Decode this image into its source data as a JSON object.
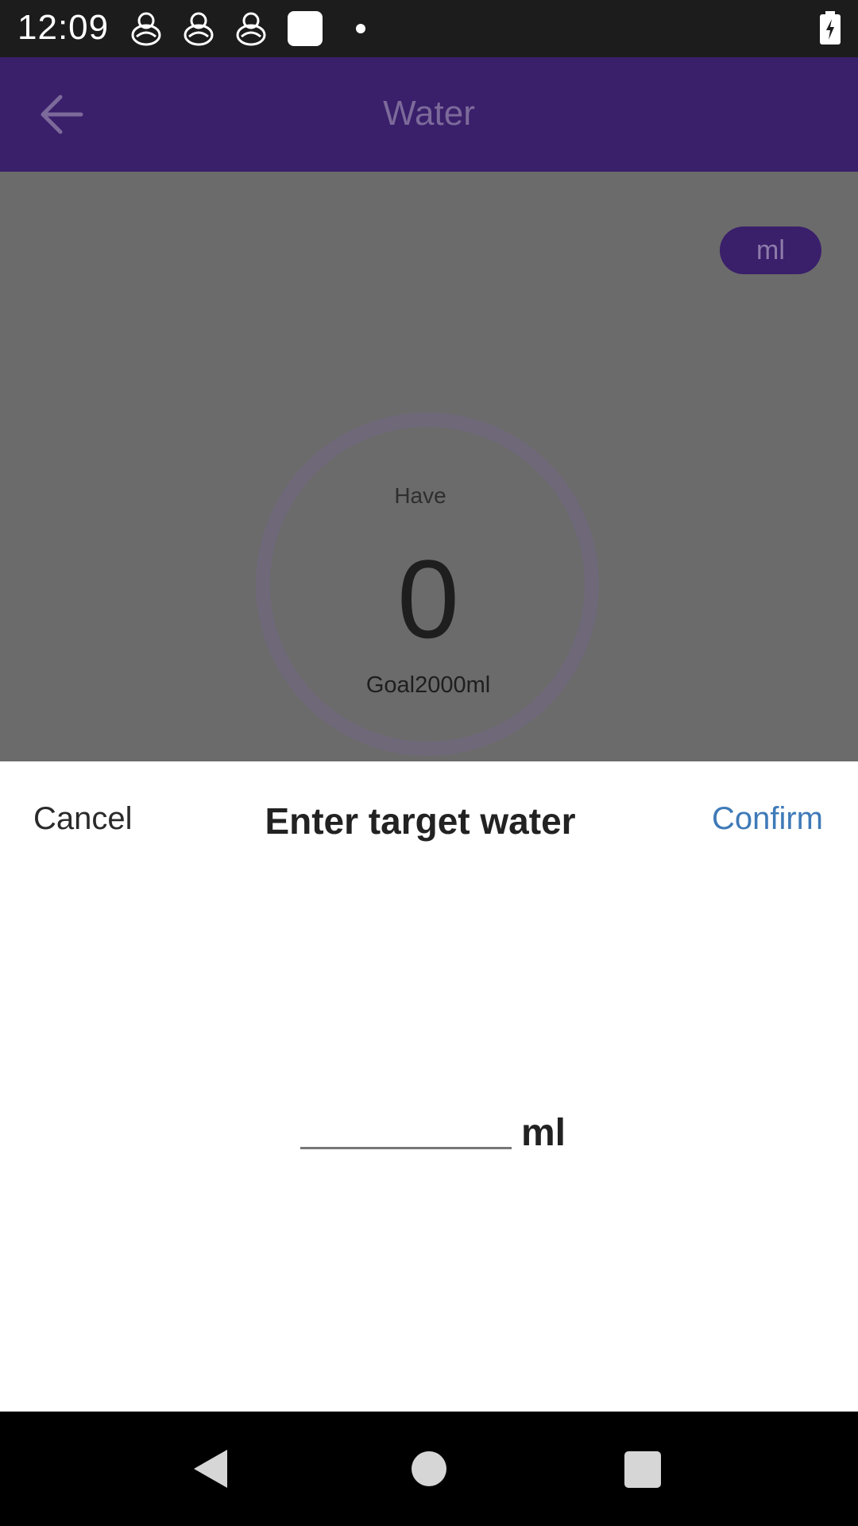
{
  "status_bar": {
    "time": "12:09",
    "notification_icons": [
      "app-notification-icon",
      "app-notification-icon",
      "app-notification-icon",
      "square-notification-icon",
      "dot-icon"
    ],
    "battery_icon": "battery-charging-icon"
  },
  "app_bar": {
    "title": "Water",
    "back_icon": "arrow-left-icon"
  },
  "water_summary": {
    "unit_toggle": "ml",
    "have_label": "Have",
    "have_value": "0",
    "goal_text": "Goal2000ml"
  },
  "dialog": {
    "cancel_label": "Cancel",
    "title": "Enter target water",
    "confirm_label": "Confirm",
    "input_value": "",
    "input_placeholder": "",
    "unit_label": "ml"
  },
  "nav_bar": {
    "icons": [
      "back-triangle-icon",
      "home-circle-icon",
      "recents-square-icon"
    ]
  },
  "colors": {
    "app_bar": "#3a1f6b",
    "confirm": "#3f7ab8",
    "scrim": "#6b6b6b"
  }
}
